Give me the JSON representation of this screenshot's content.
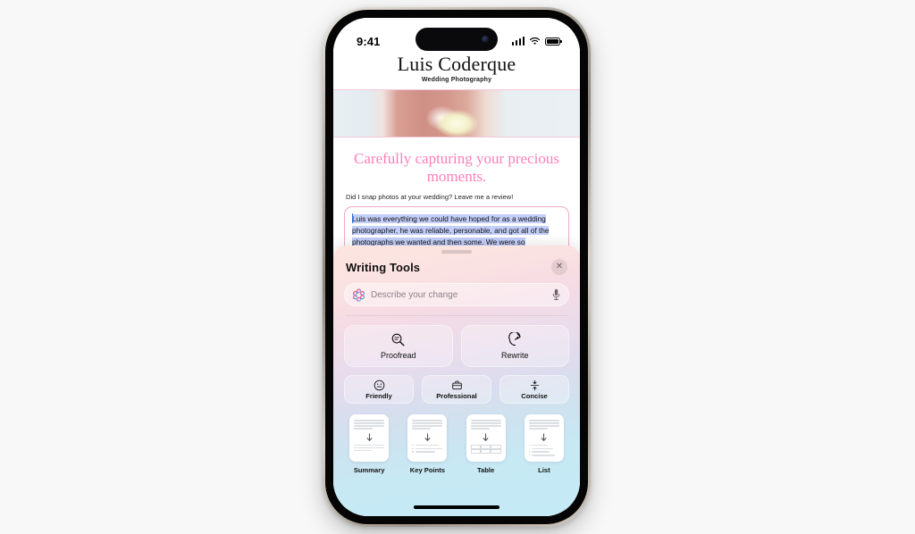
{
  "status_bar": {
    "time": "9:41",
    "signal_icon": "cellular-bars-icon",
    "wifi_icon": "wifi-icon",
    "battery_icon": "battery-icon"
  },
  "website": {
    "brand_name": "Luis Coderque",
    "brand_tagline": "Wedding Photography",
    "headline": "Carefully capturing your precious moments.",
    "review_prompt": "Did I snap photos at your wedding? Leave me a review!",
    "review_text": "Luis was everything we could have hoped for as a wedding photographer, he was reliable, personable, and got all of the photographs we wanted and then some. We were so impressed with how smoothly he circulated through our ceremony and reception. We barely realized he was there except when he was very"
  },
  "writing_tools": {
    "title": "Writing Tools",
    "close_label": "✕",
    "prompt_placeholder": "Describe your change",
    "ai_icon": "apple-intelligence-icon",
    "mic_icon": "microphone-icon",
    "main_tools": [
      {
        "label": "Proofread",
        "icon": "magnifier-lines-icon"
      },
      {
        "label": "Rewrite",
        "icon": "circular-arrow-icon"
      }
    ],
    "tone_tools": [
      {
        "label": "Friendly",
        "icon": "smiley-face-icon"
      },
      {
        "label": "Professional",
        "icon": "briefcase-icon"
      },
      {
        "label": "Concise",
        "icon": "compress-arrows-icon"
      }
    ],
    "doc_tools": [
      {
        "label": "Summary",
        "icon": "document-summary-icon"
      },
      {
        "label": "Key Points",
        "icon": "document-key-points-icon"
      },
      {
        "label": "Table",
        "icon": "document-table-icon"
      },
      {
        "label": "List",
        "icon": "document-list-icon"
      }
    ]
  },
  "colors": {
    "accent_pink": "#ff7fb8",
    "selection_blue": "#c3cffa",
    "sheet_top": "#fce6df",
    "sheet_bottom": "#c4eaf6"
  }
}
